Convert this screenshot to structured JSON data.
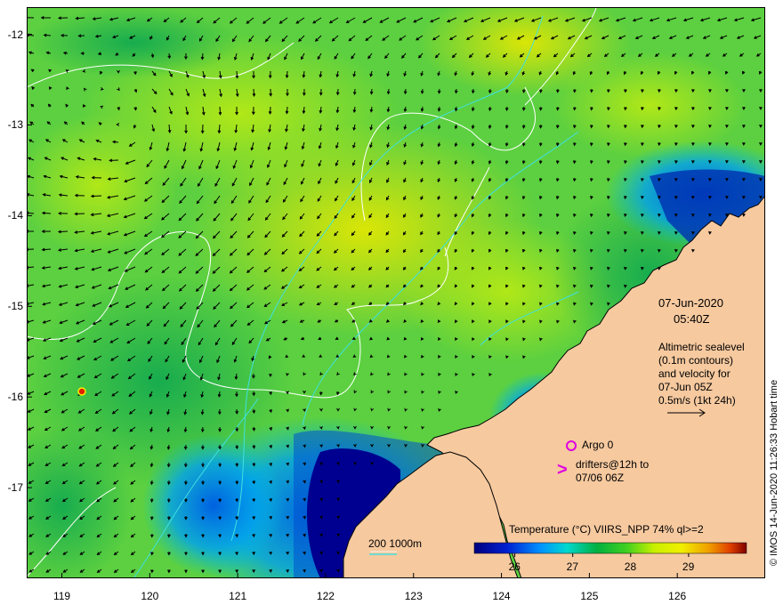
{
  "map": {
    "lat_ticks": [
      {
        "label": "-12",
        "value": -12
      },
      {
        "label": "-13",
        "value": -13
      },
      {
        "label": "-14",
        "value": -14
      },
      {
        "label": "-15",
        "value": -15
      },
      {
        "label": "-16",
        "value": -16
      },
      {
        "label": "-17",
        "value": -17
      }
    ],
    "lon_ticks": [
      {
        "label": "119",
        "value": 119
      },
      {
        "label": "120",
        "value": 120
      },
      {
        "label": "121",
        "value": 121
      },
      {
        "label": "122",
        "value": 122
      },
      {
        "label": "123",
        "value": 123
      },
      {
        "label": "124",
        "value": 124
      },
      {
        "label": "125",
        "value": 125
      },
      {
        "label": "126",
        "value": 126
      }
    ],
    "lon_range": [
      118.6,
      127.0
    ],
    "lat_range": [
      -18.0,
      -11.7
    ]
  },
  "annotations": {
    "date": "07-Jun-2020",
    "time": "05:40Z",
    "sealevel_lines": [
      "Altimetric sealevel",
      "(0.1m contours)",
      "and velocity for",
      "07-Jun 05Z",
      "0.5m/s (1kt 24h)"
    ],
    "argo_label": "Argo 0",
    "drifters_line1": "drifters@12h to",
    "drifters_line2": "07/06 06Z",
    "drifter_symbol": ">",
    "depth_legend": "200  1000m",
    "credit": "© IMOS 14-Jun-2020 11:26:33 Hobart time"
  },
  "colorbar": {
    "title": "Temperature (°C) VIIRS_NPP 74% ql>=2",
    "ticks": [
      "26",
      "27",
      "28",
      "29"
    ],
    "tick_values": [
      26,
      27,
      28,
      29
    ],
    "range": [
      25.3,
      30.0
    ]
  },
  "colors": {
    "land": "#f6c99f",
    "argo": "#e000e0",
    "contour": "#ffffff",
    "isobath": "#40e0e0",
    "arrow": "#000000"
  }
}
